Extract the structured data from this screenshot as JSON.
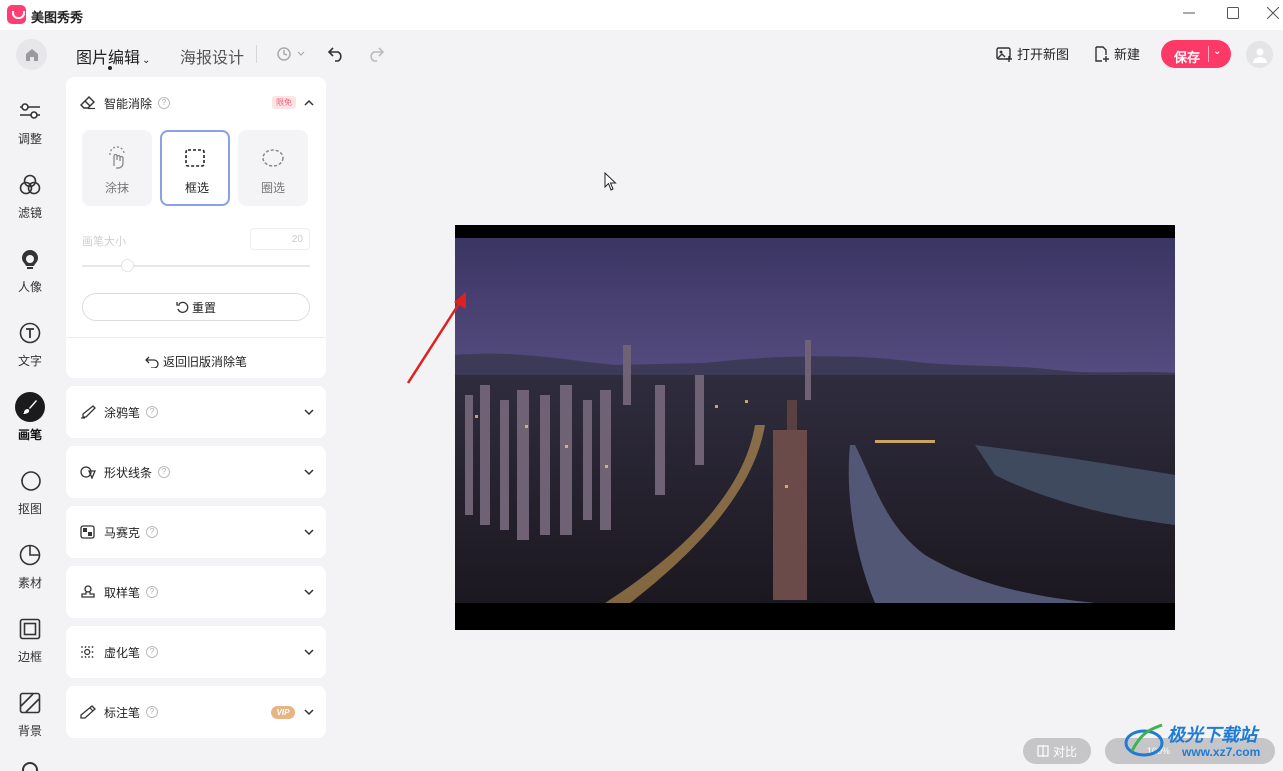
{
  "app": {
    "title": "美图秀秀"
  },
  "toolbar": {
    "tab_edit": "图片编辑",
    "tab_poster": "海报设计",
    "open_new_image": "打开新图",
    "new": "新建",
    "save": "保存"
  },
  "nav": {
    "items": [
      {
        "label": "调整",
        "icon": "sliders-icon"
      },
      {
        "label": "滤镜",
        "icon": "filter-circles-icon"
      },
      {
        "label": "人像",
        "icon": "portrait-icon"
      },
      {
        "label": "文字",
        "icon": "text-icon"
      },
      {
        "label": "画笔",
        "icon": "brush-icon",
        "active": true
      },
      {
        "label": "抠图",
        "icon": "cutout-icon"
      },
      {
        "label": "素材",
        "icon": "sticker-icon"
      },
      {
        "label": "边框",
        "icon": "frame-icon"
      },
      {
        "label": "背景",
        "icon": "background-icon"
      }
    ]
  },
  "panel": {
    "smart_erase": {
      "title": "智能消除",
      "badge": "限免",
      "modes": [
        {
          "label": "涂抹",
          "icon": "smear-hand-icon"
        },
        {
          "label": "框选",
          "icon": "rect-select-icon",
          "selected": true
        },
        {
          "label": "圈选",
          "icon": "lasso-icon"
        }
      ],
      "brush_size_label": "画笔大小",
      "brush_size_value": "20",
      "brush_size_level": 0.2,
      "reset": "重置",
      "old_version": "返回旧版消除笔"
    },
    "sections": [
      {
        "title": "涂鸦笔",
        "icon": "doodle-pen-icon"
      },
      {
        "title": "形状线条",
        "icon": "shapes-icon"
      },
      {
        "title": "马赛克",
        "icon": "mosaic-icon"
      },
      {
        "title": "取样笔",
        "icon": "stamp-icon"
      },
      {
        "title": "虚化笔",
        "icon": "blur-icon"
      },
      {
        "title": "标注笔",
        "icon": "marker-pen-icon",
        "badge": "VIP"
      }
    ]
  },
  "canvas": {
    "compare": "对比",
    "zoom": "100%"
  },
  "watermark": {
    "text": "极光下载站",
    "url": "www.xz7.com"
  },
  "colors": {
    "accent": "#fe3968",
    "selected_border": "#8aa0e8",
    "vip": "#e7b583",
    "arrow": "#e02020"
  }
}
